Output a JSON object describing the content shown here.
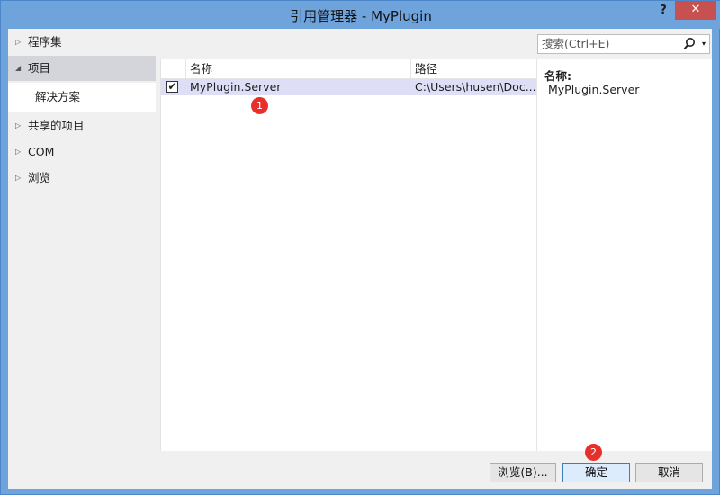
{
  "window": {
    "title": "引用管理器 - MyPlugin",
    "help": "?",
    "close": "✕"
  },
  "nav": {
    "items": [
      {
        "label": "程序集",
        "arrow": "▷"
      },
      {
        "label": "项目",
        "arrow": "◢"
      },
      {
        "label": "共享的项目",
        "arrow": "▷"
      },
      {
        "label": "COM",
        "arrow": "▷"
      },
      {
        "label": "浏览",
        "arrow": "▷"
      }
    ],
    "sub": "解决方案"
  },
  "search": {
    "placeholder": "搜索(Ctrl+E)",
    "dropdown": "▾"
  },
  "list": {
    "columns": [
      "名称",
      "路径"
    ],
    "rows": [
      {
        "checked": "✔",
        "name": "MyPlugin.Server",
        "path": "C:\\Users\\husen\\Doc..."
      }
    ]
  },
  "details": {
    "label": "名称:",
    "value": "MyPlugin.Server"
  },
  "badges": [
    "1",
    "2"
  ],
  "buttons": {
    "browse": "浏览(B)...",
    "ok": "确定",
    "cancel": "取消"
  }
}
